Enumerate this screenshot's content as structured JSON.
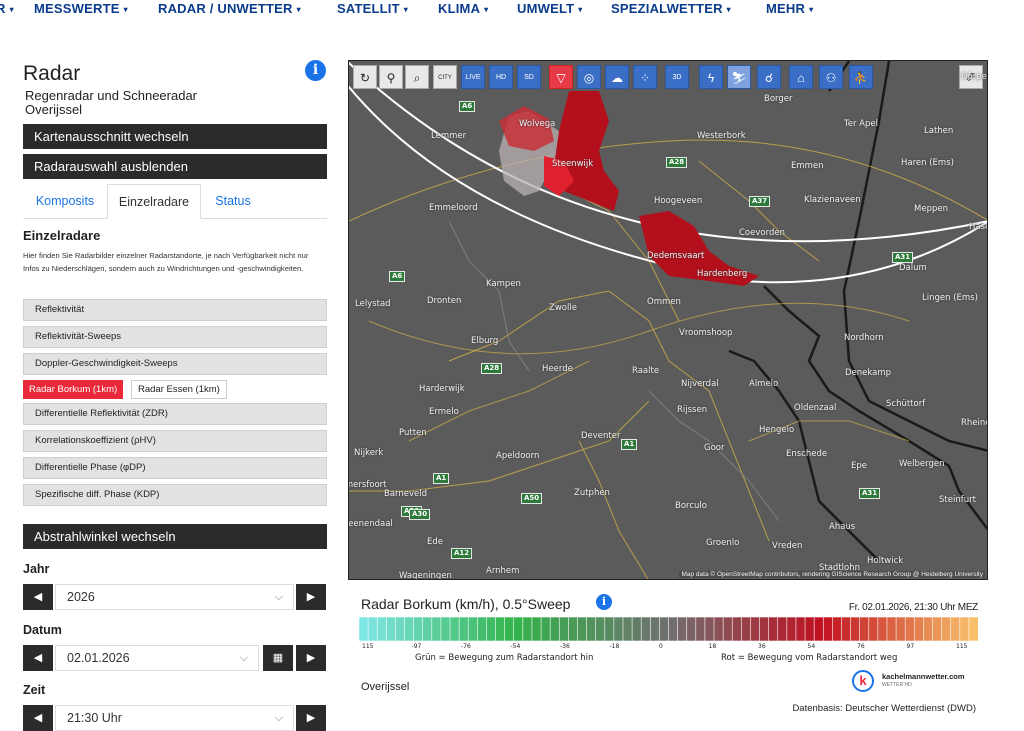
{
  "nav": {
    "items": [
      "R",
      "MESSWERTE",
      "RADAR / UNWETTER",
      "SATELLIT",
      "KLIMA",
      "UMWELT",
      "SPEZIALWETTER",
      "MEHR"
    ],
    "caret": "▾"
  },
  "panel": {
    "title": "Radar",
    "subtitle1": "Regenradar und Schneeradar",
    "subtitle2": "Overijssel",
    "info_icon": "i",
    "btn_section": "Kartenausschnitt wechseln",
    "btn_hide": "Radarauswahl ausblenden",
    "tabs": [
      "Komposits",
      "Einzelradare",
      "Status"
    ],
    "section_title": "Einzelradare",
    "description": "Hier finden Sie Radarbilder einzelner Radarstandorte, je nach Verfügbarkeit nicht nur Infos zu Niederschlägen, sondern auch zu Windrichtungen und -geschwindigkeiten.",
    "items": [
      "Reflektivität",
      "Reflektivität-Sweeps",
      "Doppler-Geschwindigkeit-Sweeps"
    ],
    "radar_active": "Radar Borkum (1km)",
    "radar_other": "Radar Essen (1km)",
    "items2": [
      "Differentielle Reflektivität (ZDR)",
      "Korrelationskoeffizient (ρHV)",
      "Differentielle Phase (φDP)",
      "Spezifische diff. Phase (KDP)"
    ],
    "btn_angle": "Abstrahlwinkel wechseln",
    "year_label": "Jahr",
    "year_value": "2026",
    "date_label": "Datum",
    "date_value": "02.01.2026",
    "time_label": "Zeit",
    "time_value": "21:30 Uhr"
  },
  "map": {
    "toolbar": [
      "↻",
      "⚲",
      "⌕",
      "CITY",
      "LIVE",
      "HD",
      "SD",
      "▽",
      "◎",
      "☁",
      "⁘",
      "3D",
      "ϟ",
      "⛷",
      "☌",
      "⌂",
      "⚇",
      "⛹"
    ],
    "share_icon": "⇗",
    "places": [
      "Lemmer",
      "Wolvega",
      "Borger",
      "Ter Apel",
      "Lathen",
      "Westerbork",
      "Steenwijk",
      "Emmen",
      "Haren (Ems)",
      "Emmeloord",
      "Hoogeveen",
      "Klazienaveen",
      "Meppen",
      "Coevorden",
      "Dedemsvaart",
      "Hardenberg",
      "Dalum",
      "Kampen",
      "Lelystad",
      "Dronten",
      "Zwolle",
      "Ommen",
      "Lingen (Ems)",
      "Elburg",
      "Vroomshoop",
      "Nordhorn",
      "Heerde",
      "Raalte",
      "Denekamp",
      "Harderwijk",
      "Nijverdal",
      "Almelo",
      "Schüttorf",
      "Ermelo",
      "Rijssen",
      "Oldenzaal",
      "Putten",
      "Deventer",
      "Hengelo",
      "Rheine",
      "Nijkerk",
      "Apeldoorn",
      "Goor",
      "Enschede",
      "Epe",
      "Welbergen",
      "Amersfoort",
      "Barneveld",
      "Zutphen",
      "Borculo",
      "Steinfurt",
      "Veenendaal",
      "Ede",
      "Groenlo",
      "Ahaus",
      "Vreden",
      "Wageningen",
      "Arnhem",
      "Stadtlohn",
      "Holtwick",
      "Dörpen",
      "Haselünne"
    ],
    "roads": [
      "A6",
      "A28",
      "A37",
      "A31",
      "A6",
      "A28",
      "A1",
      "A30",
      "A1",
      "A50",
      "A31",
      "A12",
      "A30"
    ],
    "attribution": "Map data © OpenStreetMap contributors, rendering GIScience Research Group @ Heidelberg University"
  },
  "legend": {
    "title": "Radar Borkum (km/h), 0.5°Sweep",
    "time": "Fr. 02.01.2026, 21:30 Uhr MEZ",
    "ticks": [
      "115",
      "-97",
      "-76",
      "-54",
      "-36",
      "-18",
      "0",
      "18",
      "36",
      "54",
      "76",
      "97",
      "115"
    ],
    "caption_left": "Grün = Bewegung zum Radarstandort hin",
    "caption_right": "Rot = Bewegung vom Radarstandort weg",
    "region": "Overijssel",
    "logo_text": "kachelmannwetter.com",
    "logo_sub": "WETTER HD",
    "source": "Datenbasis: Deutscher Wetterdienst (DWD)",
    "colors": {
      "negative_high": "#7fe6e6",
      "negative_mid": "#33b34a",
      "zero": "#707070",
      "positive_mid": "#c01020",
      "positive_high": "#f9c06a"
    }
  }
}
